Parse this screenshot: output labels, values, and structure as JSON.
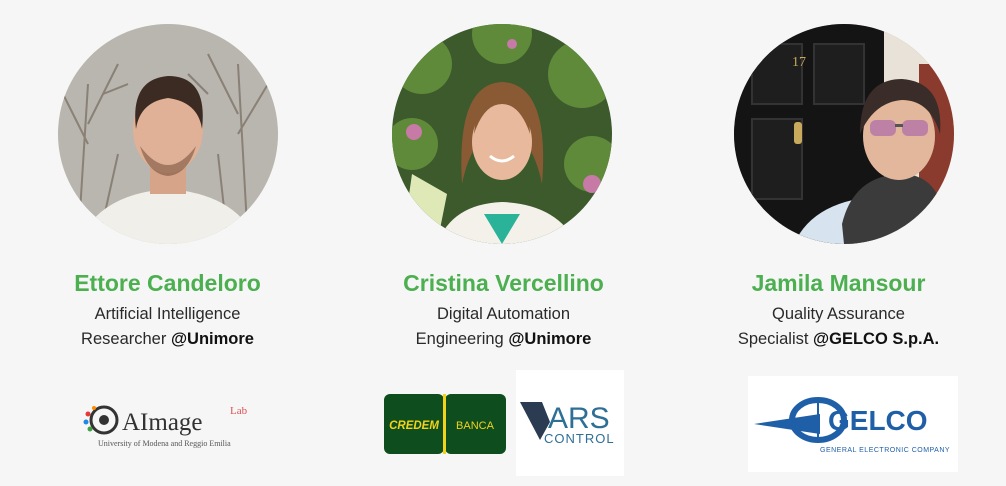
{
  "people": [
    {
      "name": "Ettore Candeloro",
      "role_line1": "Artificial Intelligence",
      "role_line2_prefix": "Researcher",
      "affiliation": "@Unimore",
      "photo_icon": "portrait-photo"
    },
    {
      "name": "Cristina Vercellino",
      "role_line1": "Digital Automation",
      "role_line2_prefix": "Engineering",
      "affiliation": "@Unimore",
      "photo_icon": "portrait-photo"
    },
    {
      "name": "Jamila Mansour",
      "role_line1": "Quality Assurance",
      "role_line2_prefix": "Specialist",
      "affiliation": "@GELCO S.p.A.",
      "photo_icon": "portrait-photo"
    }
  ],
  "logos": {
    "aimage": {
      "brand": "AImage",
      "superscript": "Lab",
      "tagline": "University of Modena and Reggio Emilia"
    },
    "credem": {
      "left": "CREDEM",
      "right": "BANCA"
    },
    "ars": {
      "top": "ARS",
      "bottom": "CONTROL"
    },
    "gelco": {
      "brand": "GELCO",
      "tagline": "GENERAL ELECTRONIC COMPANY"
    }
  },
  "colors": {
    "name_green": "#4caf50",
    "credem_green": "#0d4d1e",
    "credem_yellow": "#f2d21b",
    "gelco_blue": "#1f5fa8",
    "ars_blue": "#2e6f96"
  }
}
